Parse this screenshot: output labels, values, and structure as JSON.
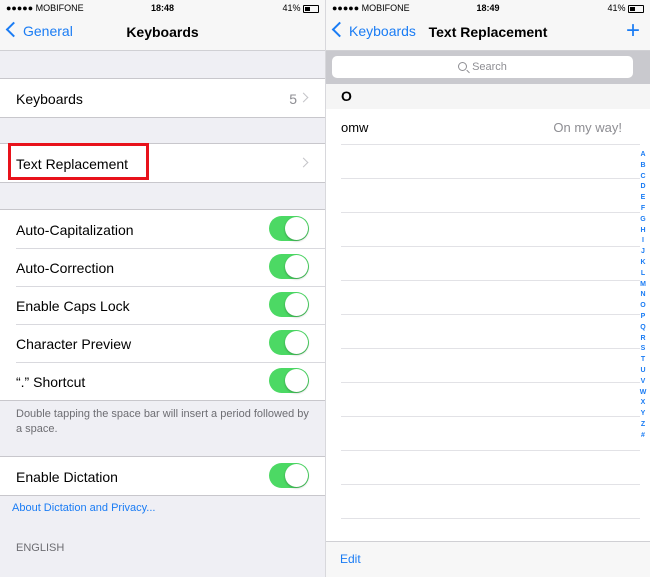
{
  "left": {
    "status": {
      "carrier": "●●●●● MOBIFONE",
      "time": "18:48",
      "battery": "41%"
    },
    "nav": {
      "back": "General",
      "title": "Keyboards"
    },
    "keyboards": {
      "label": "Keyboards",
      "count": "5"
    },
    "text_replacement": {
      "label": "Text Replacement"
    },
    "toggles": [
      {
        "label": "Auto-Capitalization",
        "on": true
      },
      {
        "label": "Auto-Correction",
        "on": true
      },
      {
        "label": "Enable Caps Lock",
        "on": true
      },
      {
        "label": "Character Preview",
        "on": true
      },
      {
        "label": "“.” Shortcut",
        "on": true
      }
    ],
    "footnote": "Double tapping the space bar will insert a period followed by a space.",
    "dictation": {
      "label": "Enable Dictation",
      "on": true
    },
    "about_link": "About Dictation and Privacy...",
    "section_english": "ENGLISH"
  },
  "right": {
    "status": {
      "carrier": "●●●●● MOBIFONE",
      "time": "18:49",
      "battery": "41%"
    },
    "nav": {
      "back": "Keyboards",
      "title": "Text Replacement",
      "add": "+"
    },
    "search": {
      "placeholder": "Search"
    },
    "section_letter": "O",
    "entries": [
      {
        "shortcut": "omw",
        "phrase": "On my way!"
      }
    ],
    "index_letters": [
      "A",
      "B",
      "C",
      "D",
      "E",
      "F",
      "G",
      "H",
      "I",
      "J",
      "K",
      "L",
      "M",
      "N",
      "O",
      "P",
      "Q",
      "R",
      "S",
      "T",
      "U",
      "V",
      "W",
      "X",
      "Y",
      "Z",
      "#"
    ],
    "toolbar": {
      "edit": "Edit"
    }
  }
}
